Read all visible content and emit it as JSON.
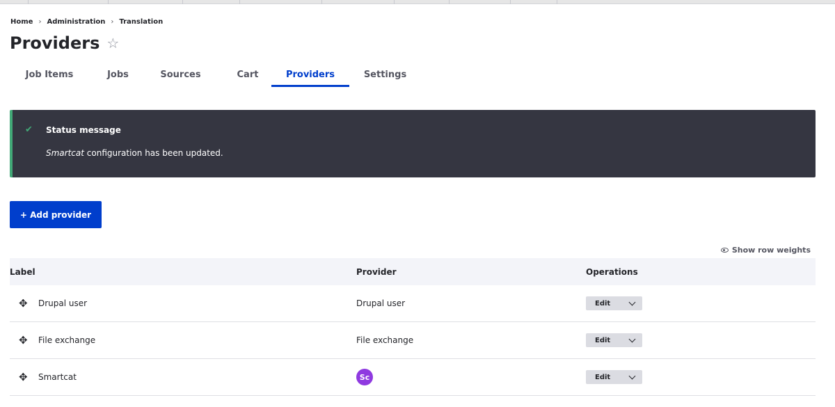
{
  "breadcrumb": [
    "Home",
    "Administration",
    "Translation"
  ],
  "breadcrumb_separator": "›",
  "page": {
    "title": "Providers",
    "star_icon": "☆"
  },
  "tabs": [
    "Job Items",
    "Jobs",
    "Sources",
    "Cart",
    "Providers",
    "Settings"
  ],
  "active_tab": "Providers",
  "status": {
    "title": "Status message",
    "check_icon": "✔",
    "message_name": "Smartcat",
    "message_rest": " configuration has been updated."
  },
  "add_button": "+ Add provider",
  "show_row_weights": "Show row weights",
  "table": {
    "headers": [
      "Label",
      "Provider",
      "Operations"
    ],
    "rows": [
      {
        "label": "Drupal user",
        "provider": "Drupal user",
        "op": "Edit"
      },
      {
        "label": "File exchange",
        "provider": "File exchange",
        "op": "Edit"
      },
      {
        "label": "Smartcat",
        "provider_logo": "Sc",
        "op": "Edit"
      }
    ]
  },
  "drag_icon": "✥",
  "colors": {
    "accent": "#003ecc",
    "status_bg": "#353641",
    "status_border": "#42a877",
    "smartcat_logo": "#8f3ae0"
  }
}
